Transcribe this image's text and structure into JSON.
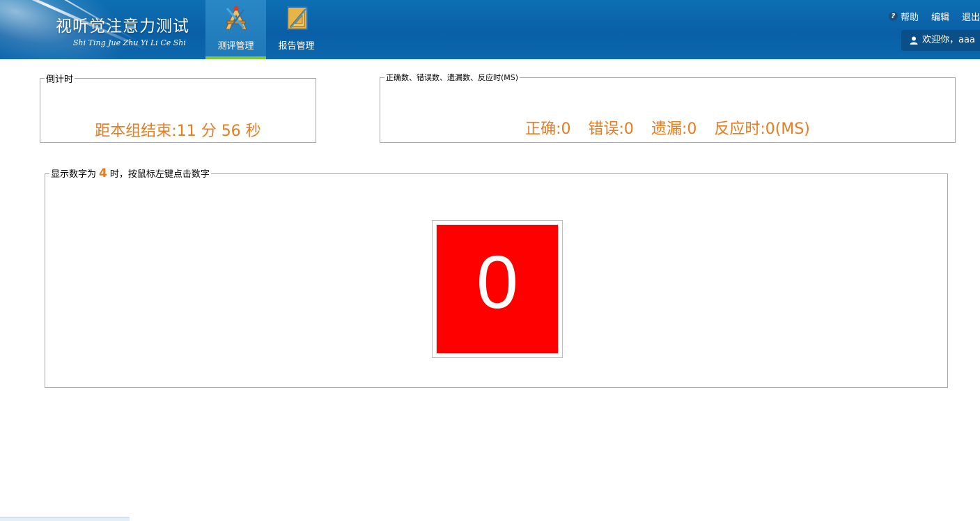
{
  "header": {
    "app_title": "视听觉注意力测试",
    "app_subtitle": "Shi Ting Jue Zhu Yi Li Ce Shi",
    "nav": [
      {
        "label": "测评管理",
        "icon": "drafting-tools-icon",
        "active": true
      },
      {
        "label": "报告管理",
        "icon": "ruler-triangle-icon",
        "active": false
      }
    ],
    "links": {
      "help": "帮助",
      "edit": "编辑",
      "logout": "退出"
    },
    "welcome": "欢迎你，aaa"
  },
  "timer": {
    "legend": "倒计时",
    "text": "距本组结束:11 分 56 秒"
  },
  "stats": {
    "legend": "正确数、错误数、遗漏数、反应时(MS)",
    "correct": "正确:0",
    "wrong": "错误:0",
    "missed": "遗漏:0",
    "reaction": "反应时:0(MS)"
  },
  "task": {
    "legend_prefix": "显示数字为",
    "target_number": "4",
    "legend_suffix": "时，按鼠标左键点击数字",
    "stimulus_digit": "0",
    "stimulus_color": "#ff0000"
  },
  "colors": {
    "header_bg": "#0a5fa6",
    "accent_orange": "#e87b1e",
    "active_tab_underline": "#7cc83a"
  }
}
